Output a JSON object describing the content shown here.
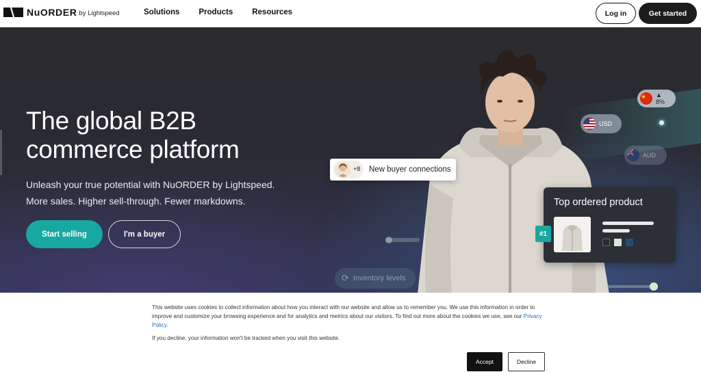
{
  "header": {
    "logo_word": "NuORDER",
    "logo_sub": "by Lightspeed",
    "nav": [
      "Solutions",
      "Products",
      "Resources"
    ],
    "login_label": "Log in",
    "cta_label": "Get started"
  },
  "hero": {
    "headline_line1": "The global B2B",
    "headline_line2": "commerce platform",
    "sub1": "Unleash your true potential with NuORDER by Lightspeed.",
    "sub2": "More sales. Higher sell-through. Fewer markdowns.",
    "primary_button": "Start selling",
    "secondary_button": "I'm a buyer"
  },
  "widgets": {
    "cn_change": "▲ 8%",
    "usd_label": "USD",
    "aud_label": "AUD",
    "connections_count": "+8",
    "connections_label": "New buyer connections",
    "inventory_label": "Inventory levels",
    "product_card_title": "Top ordered product",
    "rank_label": "#1",
    "swatch_colors": [
      "#2a2a2a",
      "#d8e6d8",
      "#1f4f78"
    ]
  },
  "cookie": {
    "text_part1": "This website uses cookies to collect information about how you interact with our website and allow us to remember you. We use this information in order to improve and customize your browsing experience and for analytics and metrics about our visitors. To find out more about the cookies we use, see our ",
    "policy_link": "Privacy Policy",
    "text_part2": ".",
    "note": "If you decline, your information won't be tracked when you visit this website.",
    "accept_label": "Accept",
    "decline_label": "Decline"
  },
  "colors": {
    "accent": "#17a8a1",
    "hero_bg": "#2b2b2e"
  }
}
